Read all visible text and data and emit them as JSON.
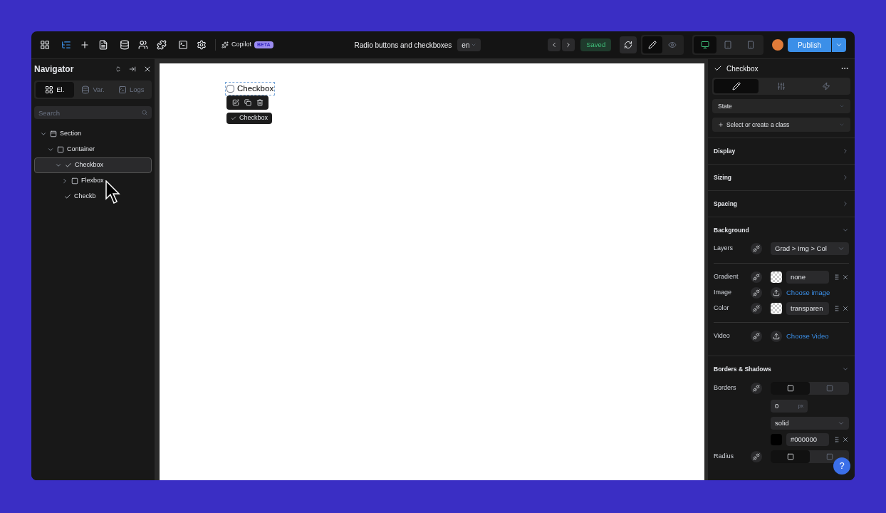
{
  "toolbar": {
    "copilot": "Copilot",
    "badge": "BETA"
  },
  "page_title": "Radio buttons and checkboxes",
  "locale": "en",
  "saved": "Saved",
  "publish": "Publish",
  "modes": [
    {
      "kind": "edit",
      "selected": true
    },
    {
      "kind": "preview",
      "selected": false
    }
  ],
  "devices": [
    {
      "kind": "desktop",
      "selected": true
    },
    {
      "kind": "tablet",
      "selected": false
    },
    {
      "kind": "phone",
      "selected": false
    }
  ],
  "navigator": {
    "title": "Navigator",
    "tabs": [
      {
        "kind": "elements",
        "label": "El.",
        "selected": true
      },
      {
        "kind": "variables",
        "label": "Var.",
        "selected": false
      },
      {
        "kind": "logs",
        "label": "Logs",
        "selected": false
      }
    ],
    "search": {
      "placeholder": "Search"
    },
    "tree": [
      {
        "kind": "section",
        "label": "Section",
        "expanded": true,
        "selected": false,
        "children": [
          {
            "kind": "box",
            "label": "Container",
            "expanded": true,
            "selected": false,
            "children": [
              {
                "kind": "check",
                "label": "Checkbox",
                "expanded": true,
                "selected": true,
                "children": [
                  {
                    "kind": "box",
                    "label": "Flexbox",
                    "expanded": false,
                    "selected": false
                  }
                ]
              },
              {
                "kind": "check",
                "label": "Checkb",
                "selected": false
              }
            ]
          }
        ]
      }
    ]
  },
  "canvas": {
    "checkbox": {
      "label": "Checkbox",
      "checked": false
    },
    "tag": "Checkbox"
  },
  "inspector": {
    "title": "Checkbox",
    "tabs": [
      {
        "kind": "style",
        "selected": true
      },
      {
        "kind": "settings",
        "selected": false
      },
      {
        "kind": "interactions",
        "selected": false
      }
    ],
    "state": "State",
    "class_placeholder": "Select or create a class",
    "sections": [
      {
        "title": "Display",
        "expanded": false
      },
      {
        "title": "Sizing",
        "expanded": false
      },
      {
        "title": "Spacing",
        "expanded": false
      },
      {
        "title": "Background",
        "expanded": true,
        "rows": [
          {
            "kind": "select",
            "label": "Layers",
            "value": "Grad > Img > Col"
          },
          {
            "kind": "divider"
          },
          {
            "kind": "swatch",
            "label": "Gradient",
            "value": "none"
          },
          {
            "kind": "upload",
            "label": "Image",
            "value": "Choose image"
          },
          {
            "kind": "swatch",
            "label": "Color",
            "value": "transparen"
          },
          {
            "kind": "divider"
          },
          {
            "kind": "upload",
            "label": "Video",
            "value": "Choose Video"
          }
        ]
      },
      {
        "title": "Borders & Shadows",
        "expanded": true,
        "rows": [
          {
            "kind": "toggle",
            "label": "Borders"
          },
          {
            "kind": "number",
            "value": "0",
            "unit": "px"
          },
          {
            "kind": "select",
            "value": "solid"
          },
          {
            "kind": "swatch",
            "value": "#000000",
            "color": "#000000"
          },
          {
            "kind": "toggle",
            "label": "Radius"
          }
        ]
      }
    ]
  },
  "help": "?"
}
